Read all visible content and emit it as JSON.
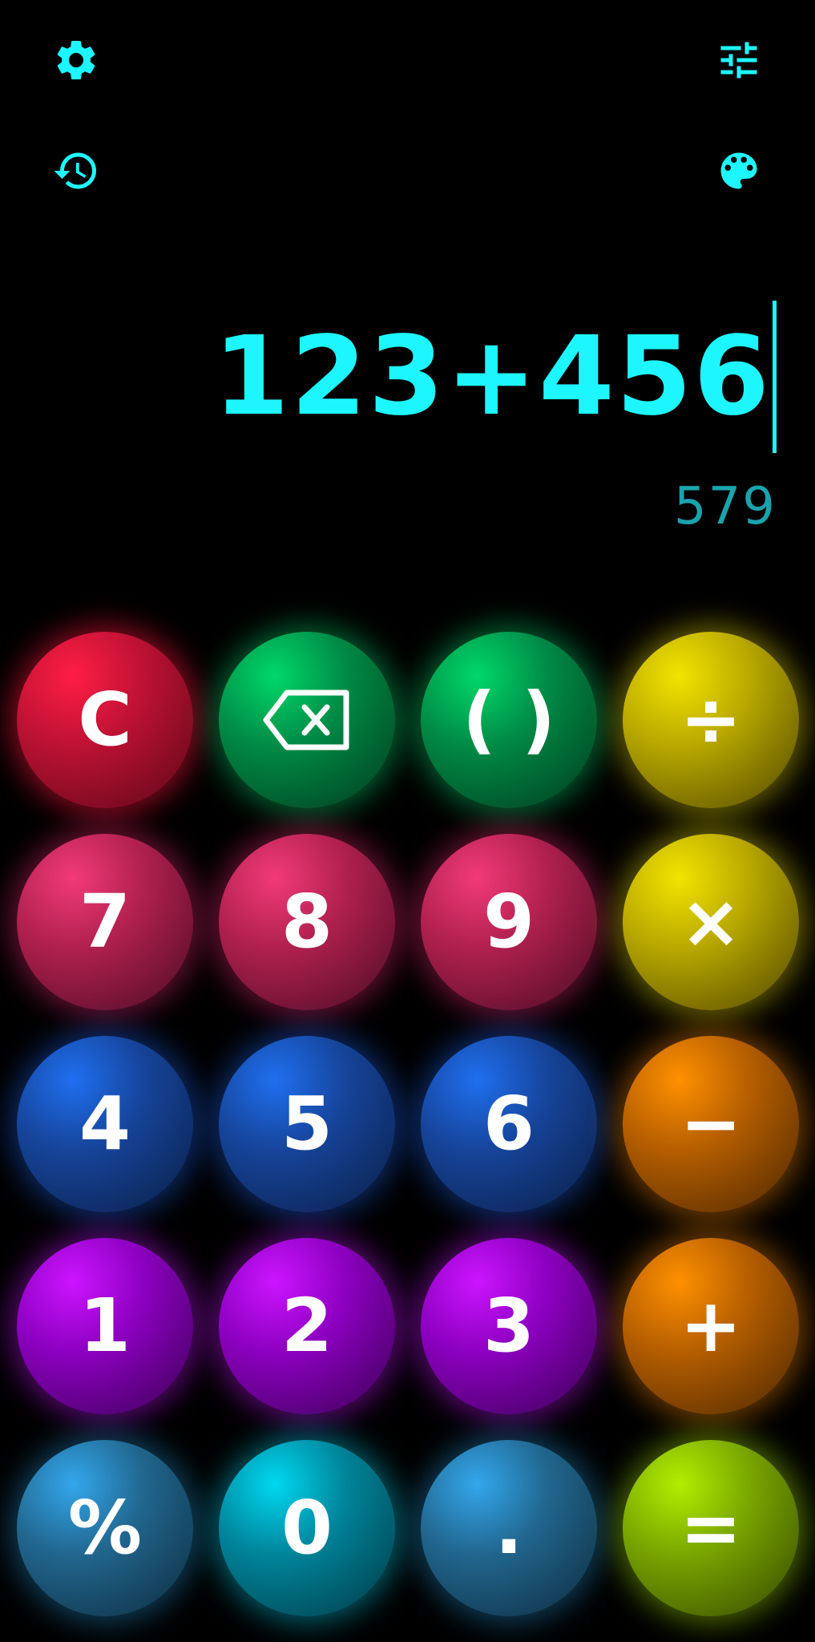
{
  "theme": {
    "accent": "#1ef6ff",
    "result_color": "#1aa3ad",
    "background": "#000000"
  },
  "toolbar": {
    "settings_icon": "gear-icon",
    "adjust_icon": "sliders-icon",
    "history_icon": "history-icon",
    "theme_icon": "palette-icon"
  },
  "display": {
    "expression": "123+456",
    "result": "579"
  },
  "keypad": {
    "clear": "C",
    "backspace_icon": "backspace-icon",
    "parentheses": "( )",
    "divide": "÷",
    "seven": "7",
    "eight": "8",
    "nine": "9",
    "multiply": "×",
    "four": "4",
    "five": "5",
    "six": "6",
    "minus": "−",
    "one": "1",
    "two": "2",
    "three": "3",
    "plus": "+",
    "percent": "%",
    "zero": "0",
    "decimal": ".",
    "equals": "="
  },
  "key_colors": {
    "clear": "#e8143c",
    "backspace": "#00b85a",
    "parentheses": "#00b85a",
    "operators_top": "#e6d600",
    "digits_789": "#d82a62",
    "digits_456": "#1a5fd6",
    "operators_bottom": "#f08400",
    "digits_123": "#b000e6",
    "percent": "#2a8cc8",
    "zero": "#00b4cc",
    "decimal": "#2a8cc8",
    "equals": "#9ad000"
  }
}
